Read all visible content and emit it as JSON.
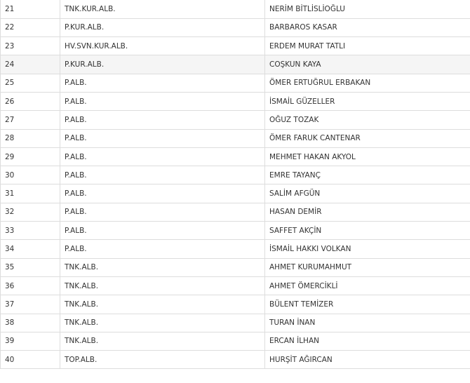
{
  "rows": [
    {
      "no": "21",
      "rank": "TNK.KUR.ALB.",
      "name": "NERİM BİTLİSLİOĞLU",
      "shaded": false
    },
    {
      "no": "22",
      "rank": "P.KUR.ALB.",
      "name": "BARBAROS KASAR",
      "shaded": false
    },
    {
      "no": "23",
      "rank": "HV.SVN.KUR.ALB.",
      "name": "ERDEM MURAT TATLI",
      "shaded": false
    },
    {
      "no": "24",
      "rank": "P.KUR.ALB.",
      "name": "COŞKUN KAYA",
      "shaded": true
    },
    {
      "no": "25",
      "rank": "P.ALB.",
      "name": "ÖMER ERTUĞRUL ERBAKAN",
      "shaded": false
    },
    {
      "no": "26",
      "rank": "P.ALB.",
      "name": "İSMAİL GÜZELLER",
      "shaded": false
    },
    {
      "no": "27",
      "rank": "P.ALB.",
      "name": "OĞUZ TOZAK",
      "shaded": false
    },
    {
      "no": "28",
      "rank": "P.ALB.",
      "name": "ÖMER FARUK CANTENAR",
      "shaded": false
    },
    {
      "no": "29",
      "rank": "P.ALB.",
      "name": "MEHMET HAKAN AKYOL",
      "shaded": false
    },
    {
      "no": "30",
      "rank": "P.ALB.",
      "name": "EMRE TAYANÇ",
      "shaded": false
    },
    {
      "no": "31",
      "rank": "P.ALB.",
      "name": "SALİM AFGÜN",
      "shaded": false
    },
    {
      "no": "32",
      "rank": "P.ALB.",
      "name": "HASAN DEMİR",
      "shaded": false
    },
    {
      "no": "33",
      "rank": "P.ALB.",
      "name": "SAFFET AKÇİN",
      "shaded": false
    },
    {
      "no": "34",
      "rank": "P.ALB.",
      "name": "İSMAİL HAKKI VOLKAN",
      "shaded": false
    },
    {
      "no": "35",
      "rank": "TNK.ALB.",
      "name": "AHMET KURUMAHMUT",
      "shaded": false
    },
    {
      "no": "36",
      "rank": "TNK.ALB.",
      "name": "AHMET ÖMERCİKLİ",
      "shaded": false
    },
    {
      "no": "37",
      "rank": "TNK.ALB.",
      "name": "BÜLENT TEMİZER",
      "shaded": false
    },
    {
      "no": "38",
      "rank": "TNK.ALB.",
      "name": "TURAN İNAN",
      "shaded": false
    },
    {
      "no": "39",
      "rank": "TNK.ALB.",
      "name": "ERCAN İLHAN",
      "shaded": false
    },
    {
      "no": "40",
      "rank": "TOP.ALB.",
      "name": "HURŞİT AĞIRCAN",
      "shaded": false
    }
  ]
}
